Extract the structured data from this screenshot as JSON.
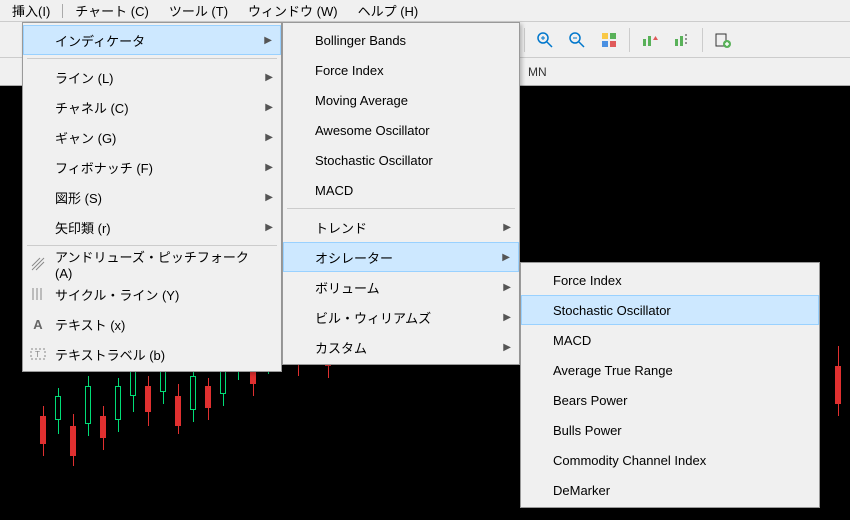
{
  "menubar": {
    "insert": "挿入(I)",
    "chart": "チャート (C)",
    "tools": "ツール (T)",
    "window": "ウィンドウ (W)",
    "help": "ヘルプ (H)"
  },
  "timeframe": {
    "mn": "MN"
  },
  "menu1": {
    "indicators": "インディケータ",
    "line": "ライン (L)",
    "channel": "チャネル (C)",
    "gann": "ギャン (G)",
    "fibonacci": "フィボナッチ (F)",
    "shapes": "図形 (S)",
    "arrows": "矢印類 (r)",
    "andrews": "アンドリューズ・ピッチフォーク (A)",
    "cycle": "サイクル・ライン (Y)",
    "text": "テキスト (x)",
    "textlabel": "テキストラベル (b)"
  },
  "menu2": {
    "bb": "Bollinger Bands",
    "fi": "Force Index",
    "ma": "Moving Average",
    "ao": "Awesome Oscillator",
    "so": "Stochastic Oscillator",
    "macd": "MACD",
    "trend": "トレンド",
    "osc": "オシレーター",
    "volume": "ボリューム",
    "bw": "ビル・ウィリアムズ",
    "custom": "カスタム"
  },
  "menu3": {
    "fi": "Force Index",
    "so": "Stochastic Oscillator",
    "macd": "MACD",
    "atr": "Average True Range",
    "bears": "Bears Power",
    "bulls": "Bulls Power",
    "cci": "Commodity Channel Index",
    "demarker": "DeMarker"
  }
}
